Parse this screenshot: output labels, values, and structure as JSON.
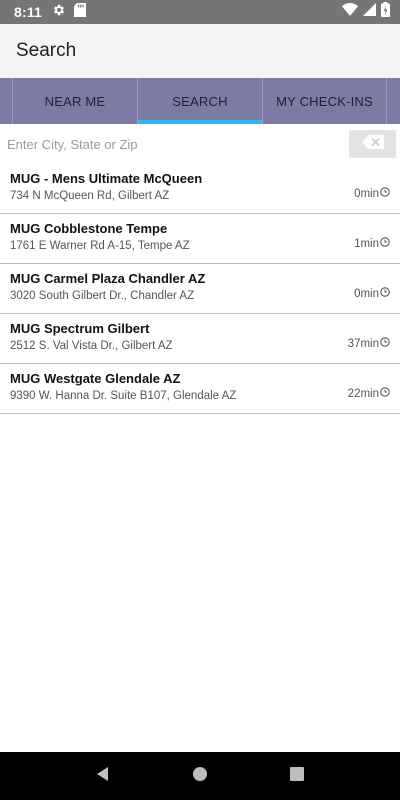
{
  "status_bar": {
    "time": "8:11",
    "icons_left": [
      "gear-icon",
      "sd-card-icon"
    ],
    "icons_right": [
      "wifi-icon",
      "signal-icon",
      "battery-icon"
    ]
  },
  "header": {
    "title": "Search"
  },
  "tabs": [
    {
      "label": "NEAR ME",
      "active": false
    },
    {
      "label": "SEARCH",
      "active": true
    },
    {
      "label": "MY CHECK-INS",
      "active": false
    }
  ],
  "search": {
    "placeholder": "Enter City, State or Zip",
    "value": ""
  },
  "results": [
    {
      "name": "MUG - Mens Ultimate McQueen",
      "address": "734 N McQueen Rd, Gilbert AZ",
      "wait": "0min"
    },
    {
      "name": "MUG Cobblestone Tempe",
      "address": "1761 E Warner Rd A-15, Tempe AZ",
      "wait": "1min"
    },
    {
      "name": "MUG Carmel Plaza Chandler AZ",
      "address": "3020 South Gilbert Dr., Chandler AZ",
      "wait": "0min"
    },
    {
      "name": "MUG Spectrum Gilbert",
      "address": "2512 S. Val Vista Dr., Gilbert AZ",
      "wait": "37min"
    },
    {
      "name": "MUG Westgate Glendale AZ",
      "address": "9390 W. Hanna Dr. Suite B107, Glendale AZ",
      "wait": "22min"
    }
  ],
  "colors": {
    "tab_bar_bg": "#7b7ba3",
    "tab_indicator": "#29b6f6",
    "status_bar_bg": "#757575",
    "app_bar_bg": "#f4f4f4"
  }
}
